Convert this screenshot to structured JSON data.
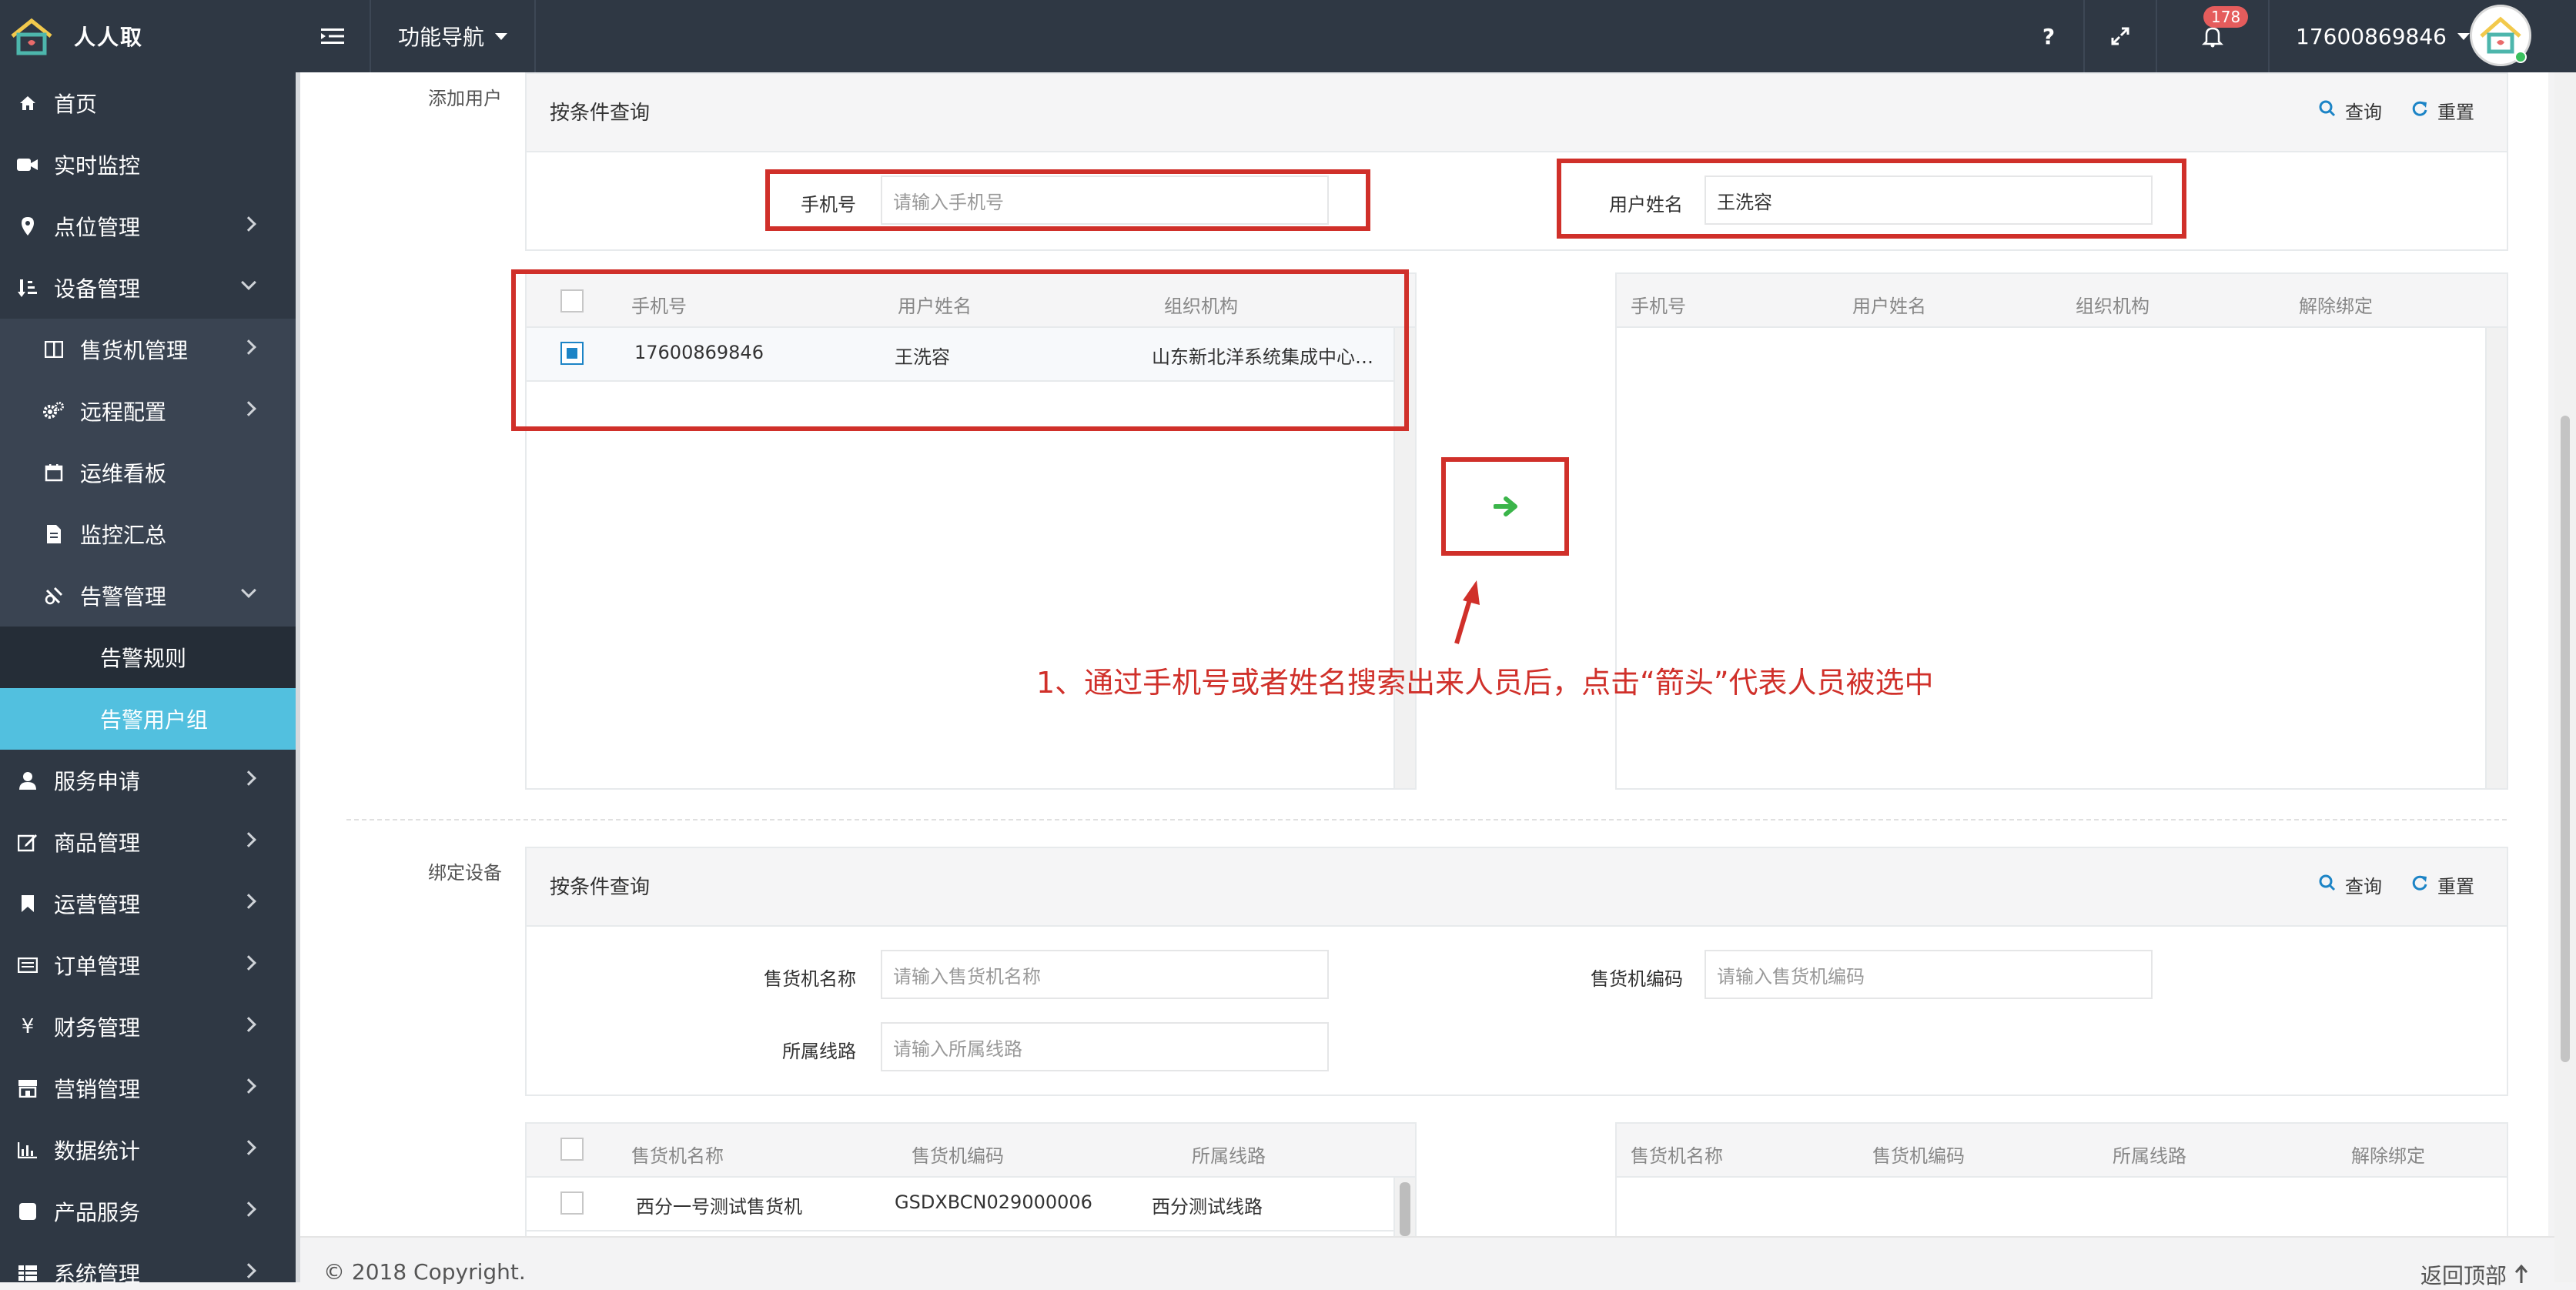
{
  "topbar": {
    "app_name": "人人取",
    "nav_label": "功能导航",
    "help_label": "?",
    "notification_count": "178",
    "user_phone": "17600869846"
  },
  "sidebar": {
    "items": [
      {
        "label": "首页",
        "icon": "home-icon"
      },
      {
        "label": "实时监控",
        "icon": "video-camera-icon"
      },
      {
        "label": "点位管理",
        "icon": "map-pin-icon"
      },
      {
        "label": "设备管理",
        "icon": "sort-icon"
      },
      {
        "label": "售货机管理",
        "icon": "columns-icon"
      },
      {
        "label": "远程配置",
        "icon": "gears-icon"
      },
      {
        "label": "运维看板",
        "icon": "calendar-icon"
      },
      {
        "label": "监控汇总",
        "icon": "file-icon"
      },
      {
        "label": "告警管理",
        "icon": "alarm-icon"
      },
      {
        "label": "告警规则",
        "icon": ""
      },
      {
        "label": "告警用户组",
        "icon": ""
      },
      {
        "label": "服务申请",
        "icon": "user-icon"
      },
      {
        "label": "商品管理",
        "icon": "edit-icon"
      },
      {
        "label": "运营管理",
        "icon": "bookmark-icon"
      },
      {
        "label": "订单管理",
        "icon": "list-icon"
      },
      {
        "label": "财务管理",
        "icon": "yen-icon"
      },
      {
        "label": "营销管理",
        "icon": "store-icon"
      },
      {
        "label": "数据统计",
        "icon": "bar-chart-icon"
      },
      {
        "label": "产品服务",
        "icon": "square-icon"
      },
      {
        "label": "系统管理",
        "icon": "table-icon"
      }
    ]
  },
  "add_user": {
    "section_label": "添加用户",
    "panel_title": "按条件查询",
    "query_label": "查询",
    "reset_label": "重置",
    "phone_label": "手机号",
    "phone_placeholder": "请输入手机号",
    "name_label": "用户姓名",
    "name_value": "王洗容",
    "left_grid": {
      "columns": [
        "手机号",
        "用户姓名",
        "组织机构"
      ],
      "rows": [
        {
          "phone": "17600869846",
          "name": "王洗容",
          "org": "山东新北洋系统集成中心…",
          "checked": true
        }
      ]
    },
    "right_grid": {
      "columns": [
        "手机号",
        "用户姓名",
        "组织机构",
        "解除绑定"
      ]
    }
  },
  "annotation": {
    "text": "1、通过手机号或者姓名搜索出来人员后，点击“箭头”代表人员被选中",
    "color": "#d0302a"
  },
  "bind_device": {
    "section_label": "绑定设备",
    "panel_title": "按条件查询",
    "query_label": "查询",
    "reset_label": "重置",
    "machine_name_label": "售货机名称",
    "machine_name_placeholder": "请输入售货机名称",
    "machine_code_label": "售货机编码",
    "machine_code_placeholder": "请输入售货机编码",
    "route_label": "所属线路",
    "route_placeholder": "请输入所属线路",
    "left_grid": {
      "columns": [
        "售货机名称",
        "售货机编码",
        "所属线路"
      ],
      "rows": [
        {
          "name": "西分一号测试售货机",
          "code": "GSDXBCN029000006",
          "route": "西分测试线路"
        }
      ]
    },
    "right_grid": {
      "columns": [
        "售货机名称",
        "售货机编码",
        "所属线路",
        "解除绑定"
      ]
    }
  },
  "footer": {
    "copyright": "© 2018 Copyright.",
    "back_to_top": "返回顶部"
  },
  "colors": {
    "sidebar_bg": "#2f3844",
    "active_item": "#52c0df",
    "accent": "#1c84c6",
    "arrow_green": "#3bb54a",
    "badge_red": "#e55c5c"
  }
}
